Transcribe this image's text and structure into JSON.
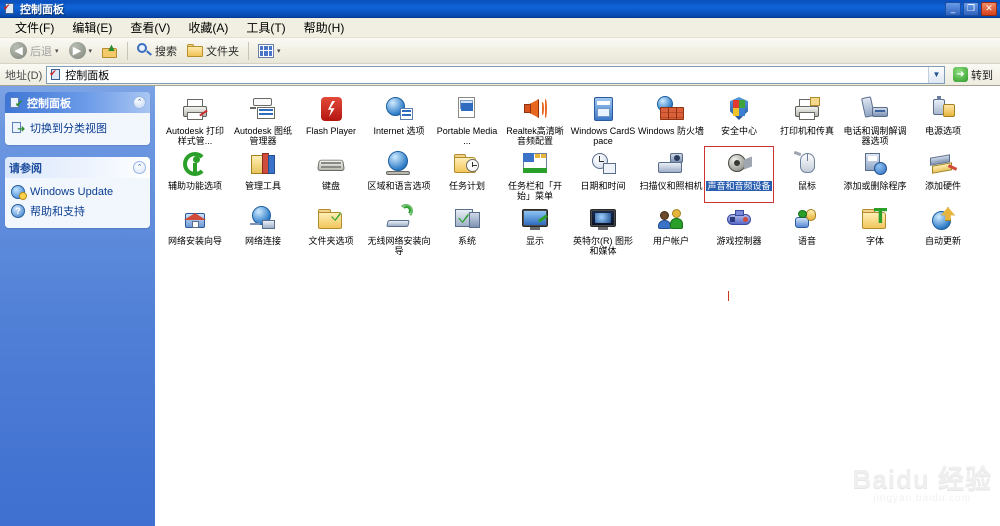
{
  "window": {
    "title": "控制面板",
    "icon": "control-panel-icon",
    "buttons": {
      "minimize": "_",
      "maximize": "❐",
      "close": "✕"
    }
  },
  "menubar": {
    "items": [
      {
        "label": "文件(F)"
      },
      {
        "label": "编辑(E)"
      },
      {
        "label": "查看(V)"
      },
      {
        "label": "收藏(A)"
      },
      {
        "label": "工具(T)"
      },
      {
        "label": "帮助(H)"
      }
    ]
  },
  "toolbar": {
    "back_label": "后退",
    "forward_label": "",
    "up_label": "",
    "search_label": "搜索",
    "folders_label": "文件夹",
    "views_label": ""
  },
  "addressbar": {
    "label": "地址(D)",
    "value": "控制面板",
    "dropdown": "▼",
    "go_label": "转到",
    "go_arrow": "➜"
  },
  "sidebar": {
    "panels": [
      {
        "title": "控制面板",
        "style": "blue",
        "icon": "control-panel-icon",
        "collapse": "⌃",
        "links": [
          {
            "label": "切换到分类视图",
            "icon": "switch-view-icon"
          }
        ]
      },
      {
        "title": "请参阅",
        "style": "light",
        "collapse": "⌃",
        "links": [
          {
            "label": "Windows Update",
            "icon": "windows-update-icon"
          },
          {
            "label": "帮助和支持",
            "icon": "help-support-icon"
          }
        ]
      }
    ]
  },
  "content": {
    "selected_index": 20,
    "items": [
      {
        "label": "Autodesk 打印样式管...",
        "icon": "printer-style-icon"
      },
      {
        "label": "Autodesk 图纸管理器",
        "icon": "sheet-set-icon"
      },
      {
        "label": "Flash Player",
        "icon": "flash-player-icon"
      },
      {
        "label": "Internet 选项",
        "icon": "internet-options-icon"
      },
      {
        "label": "Portable Media ...",
        "icon": "portable-media-icon"
      },
      {
        "label": "Realtek高清晰音频配置",
        "icon": "realtek-audio-icon"
      },
      {
        "label": "Windows CardSpace",
        "icon": "cardspace-icon"
      },
      {
        "label": "Windows 防火墙",
        "icon": "firewall-icon"
      },
      {
        "label": "安全中心",
        "icon": "security-center-icon"
      },
      {
        "label": "打印机和传真",
        "icon": "printers-faxes-icon"
      },
      {
        "label": "电话和调制解调器选项",
        "icon": "phone-modem-icon"
      },
      {
        "label": "电源选项",
        "icon": "power-options-icon"
      },
      {
        "label": "辅助功能选项",
        "icon": "accessibility-icon"
      },
      {
        "label": "管理工具",
        "icon": "admin-tools-icon"
      },
      {
        "label": "键盘",
        "icon": "keyboard-icon"
      },
      {
        "label": "区域和语言选项",
        "icon": "regional-options-icon"
      },
      {
        "label": "任务计划",
        "icon": "scheduled-tasks-icon"
      },
      {
        "label": "任务栏和「开始」菜单",
        "icon": "taskbar-startmenu-icon"
      },
      {
        "label": "日期和时间",
        "icon": "date-time-icon"
      },
      {
        "label": "扫描仪和照相机",
        "icon": "scanners-cameras-icon"
      },
      {
        "label": "声音和音频设备",
        "icon": "sounds-audio-icon"
      },
      {
        "label": "鼠标",
        "icon": "mouse-icon"
      },
      {
        "label": "添加或删除程序",
        "icon": "add-remove-programs-icon"
      },
      {
        "label": "添加硬件",
        "icon": "add-hardware-icon"
      },
      {
        "label": "网络安装向导",
        "icon": "network-setup-wizard-icon"
      },
      {
        "label": "网络连接",
        "icon": "network-connections-icon"
      },
      {
        "label": "文件夹选项",
        "icon": "folder-options-icon"
      },
      {
        "label": "无线网络安装向导",
        "icon": "wireless-network-wizard-icon"
      },
      {
        "label": "系统",
        "icon": "system-icon"
      },
      {
        "label": "显示",
        "icon": "display-icon"
      },
      {
        "label": "英特尔(R) 图形和媒体",
        "icon": "intel-graphics-icon"
      },
      {
        "label": "用户帐户",
        "icon": "user-accounts-icon"
      },
      {
        "label": "游戏控制器",
        "icon": "game-controllers-icon"
      },
      {
        "label": "语音",
        "icon": "speech-icon"
      },
      {
        "label": "字体",
        "icon": "fonts-icon"
      },
      {
        "label": "自动更新",
        "icon": "automatic-updates-icon"
      }
    ]
  },
  "watermark": {
    "main": "Baidu 经验",
    "sub": "jingyan.baidu.com"
  }
}
